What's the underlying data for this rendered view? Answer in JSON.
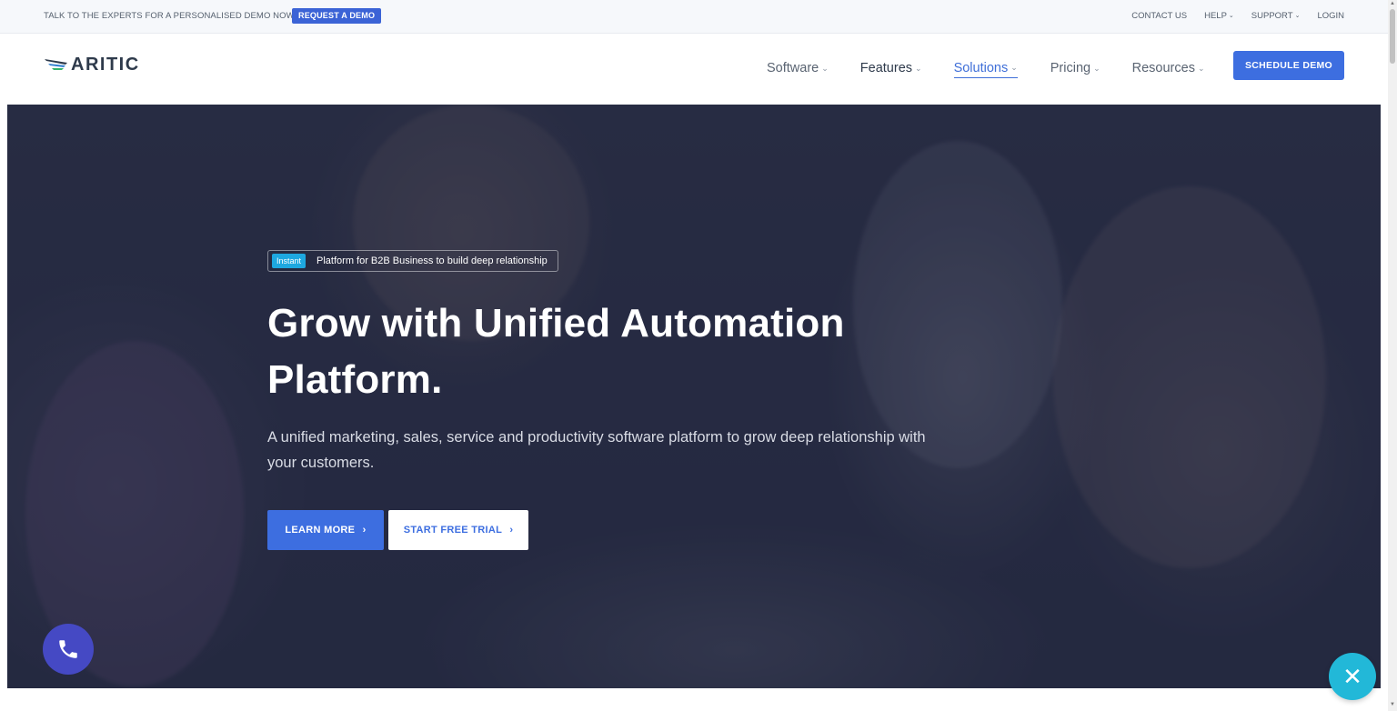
{
  "topbar": {
    "promo_text": "TALK TO THE EXPERTS FOR A PERSONALISED DEMO NOW!",
    "request_demo_label": "REQUEST A DEMO",
    "links": [
      "CONTACT US",
      "HELP",
      "SUPPORT",
      "LOGIN"
    ]
  },
  "nav": {
    "logo_text": "ARITIC",
    "items": [
      "Software",
      "Features",
      "Solutions",
      "Pricing",
      "Resources"
    ],
    "active_item": "Solutions",
    "cta_label": "SCHEDULE DEMO"
  },
  "hero": {
    "badge": "Instant",
    "tagline": "Platform for B2B Business to build deep relationship",
    "title_line1": "Grow with Unified Automation",
    "title_line2": "Platform.",
    "subtitle": "A unified marketing, sales, service and productivity software platform to grow deep relationship with your customers.",
    "primary_btn": "LEARN MORE",
    "secondary_btn": "START FREE TRIAL"
  },
  "floating": {
    "phone_icon": "phone-icon",
    "close_icon": "close-icon"
  },
  "colors": {
    "accent": "#3d6ee0",
    "badge": "#1ea8e0",
    "phone_fab": "#4549c4",
    "close_fab": "#22b8d8"
  }
}
